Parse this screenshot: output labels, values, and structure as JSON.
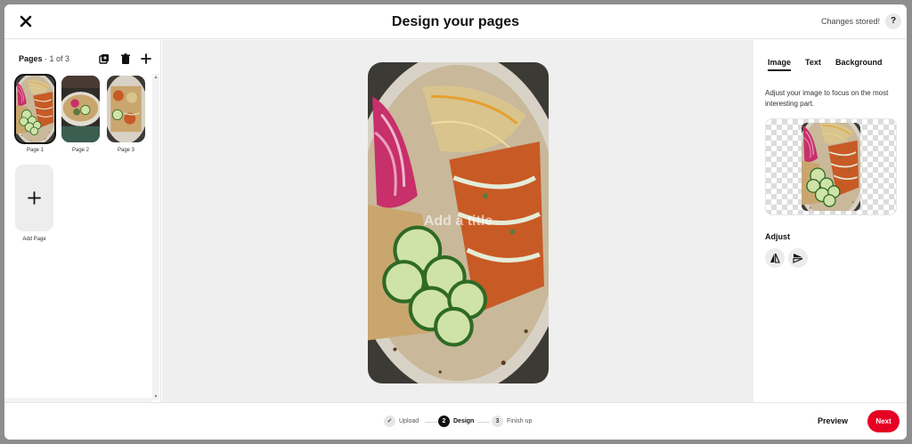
{
  "header": {
    "title": "Design your pages",
    "status": "Changes stored!",
    "help_label": "?"
  },
  "pages_panel": {
    "heading": "Pages",
    "count": "1 of 3",
    "pages": [
      {
        "label": "Page 1",
        "selected": true
      },
      {
        "label": "Page 2",
        "selected": false
      },
      {
        "label": "Page 3",
        "selected": false
      }
    ],
    "add_page_label": "Add Page"
  },
  "canvas": {
    "title_placeholder": "Add a title"
  },
  "side_panel": {
    "tabs": [
      {
        "label": "Image",
        "active": true
      },
      {
        "label": "Text",
        "active": false
      },
      {
        "label": "Background",
        "active": false
      }
    ],
    "description": "Adjust your image to focus on the most interesting part.",
    "adjust_label": "Adjust"
  },
  "footer": {
    "steps": [
      {
        "label": "Upload",
        "marker": "✓",
        "state": "done"
      },
      {
        "label": "Design",
        "marker": "2",
        "state": "active"
      },
      {
        "label": "Finish up",
        "marker": "3",
        "state": "upcoming"
      }
    ],
    "preview_label": "Preview",
    "next_label": "Next"
  },
  "colors": {
    "accent": "#e60023",
    "active_step": "#111111"
  }
}
